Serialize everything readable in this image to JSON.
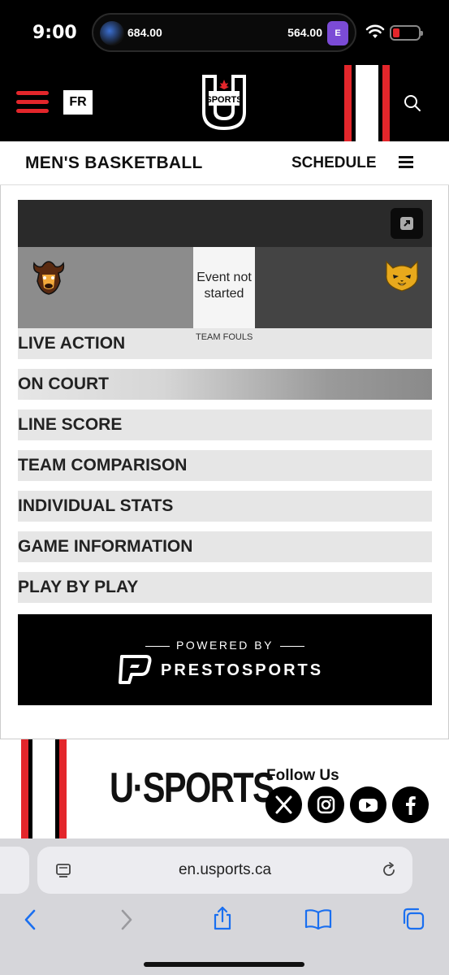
{
  "status_bar": {
    "time": "9:00",
    "left_value": "684.00",
    "right_value": "564.00",
    "jersey_letter": "E"
  },
  "header": {
    "lang_button": "FR",
    "logo_text": "SPORTS",
    "accent_color": "#e3262b"
  },
  "subnav": {
    "sport_title": "MEN'S BASKETBALL",
    "schedule_label": "SCHEDULE"
  },
  "game": {
    "status": "Event not started",
    "team_fouls_label": "TEAM FOULS"
  },
  "tabs": [
    "LIVE ACTION",
    "ON COURT",
    "LINE SCORE",
    "TEAM COMPARISON",
    "INDIVIDUAL STATS",
    "GAME INFORMATION",
    "PLAY BY PLAY"
  ],
  "powered": {
    "by": "POWERED BY",
    "brand": "PRESTOSPORTS"
  },
  "footer": {
    "logo": "U·SPORTS",
    "follow": "Follow Us",
    "social": [
      "x-icon",
      "instagram-icon",
      "youtube-icon",
      "facebook-icon"
    ]
  },
  "browser": {
    "url": "en.usports.ca"
  }
}
